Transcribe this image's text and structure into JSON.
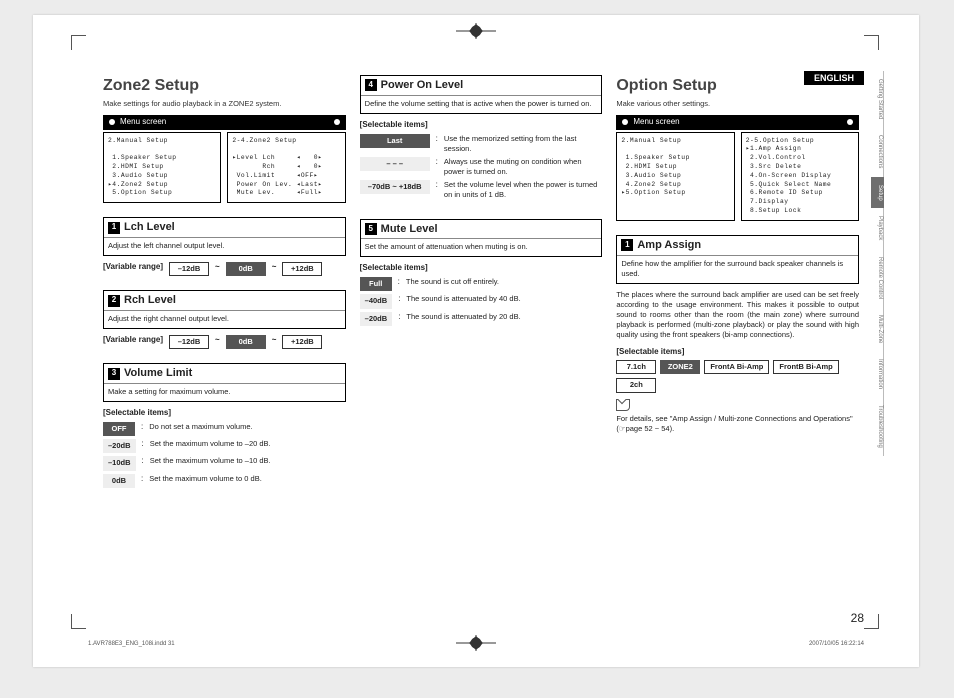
{
  "lang": "ENGLISH",
  "sidebar": [
    "Getting Started",
    "Connections",
    "Setup",
    "Playback",
    "Remote Control",
    "Multi-Zone",
    "Information",
    "Troubleshooting"
  ],
  "sidebar_active_index": 2,
  "col1": {
    "title": "Zone2 Setup",
    "sub": "Make settings for audio playback in a ZONE2 system.",
    "menu_label": "Menu screen",
    "screen1": "2.Manual Setup\n\n 1.Speaker Setup\n 2.HDMI Setup\n 3.Audio Setup\n▸4.Zone2 Setup\n 5.Option Setup",
    "screen2": "2-4.Zone2 Setup\n\n▸Level Lch     ◂   0▸\n       Rch     ◂   0▸\n Vol.Limit     ◂OFF▸\n Power On Lev. ◂Last▸\n Mute Lev.     ◂Full▸",
    "sec1": {
      "num": "1",
      "title": "Lch Level",
      "desc": "Adjust the left channel output level.",
      "range_label": "[Variable range]",
      "range": [
        "–12dB",
        "0dB",
        "+12dB"
      ]
    },
    "sec2": {
      "num": "2",
      "title": "Rch Level",
      "desc": "Adjust the right channel output level.",
      "range_label": "[Variable range]",
      "range": [
        "–12dB",
        "0dB",
        "+12dB"
      ]
    },
    "sec3": {
      "num": "3",
      "title": "Volume Limit",
      "desc": "Make a setting for maximum volume.",
      "items_label": "[Selectable items]",
      "items": [
        {
          "k": "OFF",
          "dark": true,
          "v": "Do not set a maximum volume."
        },
        {
          "k": "–20dB",
          "v": "Set the maximum volume to –20 dB."
        },
        {
          "k": "–10dB",
          "v": "Set the maximum volume to –10 dB."
        },
        {
          "k": "0dB",
          "v": "Set the maximum volume to 0 dB."
        }
      ]
    }
  },
  "col2": {
    "sec4": {
      "num": "4",
      "title": "Power On Level",
      "desc": "Define the volume setting that is active when the power is turned on.",
      "items_label": "[Selectable items]",
      "items": [
        {
          "k": "Last",
          "dark": true,
          "v": "Use the memorized setting from the last session."
        },
        {
          "k": "– – –",
          "v": "Always use the muting on condition when power is turned on."
        },
        {
          "k": "–70dB ~ +18dB",
          "v": "Set the volume level when the power is turned on in units of 1 dB."
        }
      ]
    },
    "sec5": {
      "num": "5",
      "title": "Mute Level",
      "desc": "Set the amount of attenuation when muting is on.",
      "items_label": "[Selectable items]",
      "items": [
        {
          "k": "Full",
          "dark": true,
          "v": "The sound is cut off entirely."
        },
        {
          "k": "–40dB",
          "v": "The sound is attenuated by 40 dB."
        },
        {
          "k": "–20dB",
          "v": "The sound is attenuated by 20 dB."
        }
      ]
    }
  },
  "col3": {
    "title": "Option Setup",
    "sub": "Make various other settings.",
    "menu_label": "Menu screen",
    "screen1": "2.Manual Setup\n\n 1.Speaker Setup\n 2.HDMI Setup\n 3.Audio Setup\n 4.Zone2 Setup\n▸5.Option Setup",
    "screen2": "2-5.Option Setup\n▸1.Amp Assign\n 2.Vol.Control\n 3.Src Delete\n 4.On-Screen Display\n 5.Quick Select Name\n 6.Remote ID Setup\n 7.Display\n 8.Setup Lock",
    "sec1": {
      "num": "1",
      "title": "Amp Assign",
      "desc": "Define how the amplifier for the surround back speaker channels is used."
    },
    "para": "The places where the surround back amplifier are used can be set freely according to the usage environment. This makes it possible to output sound to rooms other than the room (the main zone) where surround playback is performed (multi-zone playback) or play the sound with high quality using the front speakers (bi-amp connections).",
    "items_label": "[Selectable items]",
    "options": [
      {
        "k": "7.1ch"
      },
      {
        "k": "ZONE2",
        "dark": true
      },
      {
        "k": "FrontA Bi-Amp"
      },
      {
        "k": "FrontB Bi-Amp"
      },
      {
        "k": "2ch"
      }
    ],
    "note": "For details, see \"Amp Assign / Multi-zone Connections and Operations\" (☞page 52 ~ 54)."
  },
  "page_number": "28",
  "footer_left": "1.AVR788E3_ENG_108i.indd   31",
  "footer_right": "2007/10/05   16:22:14"
}
